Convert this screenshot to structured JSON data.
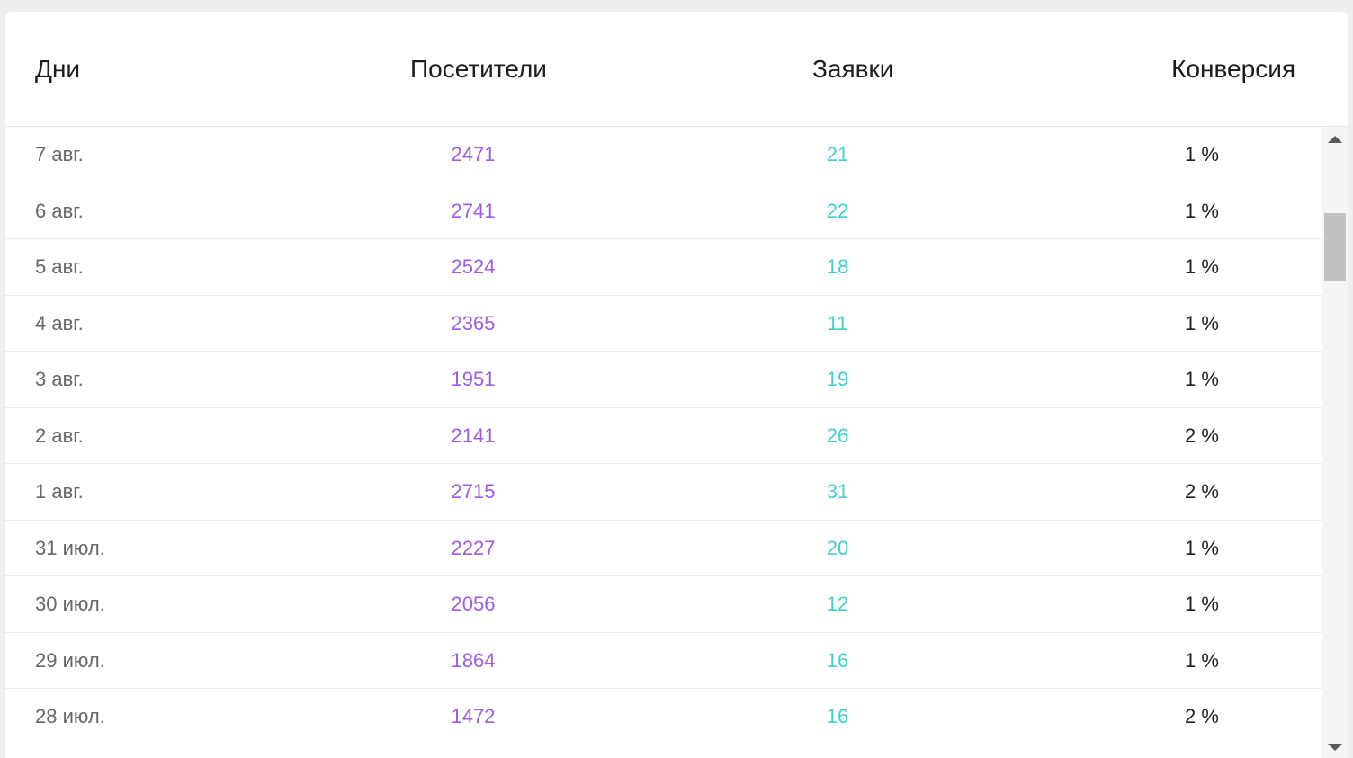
{
  "table": {
    "headers": {
      "days": "Дни",
      "visitors": "Посетители",
      "requests": "Заявки",
      "conversion": "Конверсия"
    },
    "rows": [
      {
        "day": "7 авг.",
        "visitors": "2471",
        "requests": "21",
        "conversion": "1 %"
      },
      {
        "day": "6 авг.",
        "visitors": "2741",
        "requests": "22",
        "conversion": "1 %"
      },
      {
        "day": "5 авг.",
        "visitors": "2524",
        "requests": "18",
        "conversion": "1 %"
      },
      {
        "day": "4 авг.",
        "visitors": "2365",
        "requests": "11",
        "conversion": "1 %"
      },
      {
        "day": "3 авг.",
        "visitors": "1951",
        "requests": "19",
        "conversion": "1 %"
      },
      {
        "day": "2 авг.",
        "visitors": "2141",
        "requests": "26",
        "conversion": "2 %"
      },
      {
        "day": "1 авг.",
        "visitors": "2715",
        "requests": "31",
        "conversion": "2 %"
      },
      {
        "day": "31 июл.",
        "visitors": "2227",
        "requests": "20",
        "conversion": "1 %"
      },
      {
        "day": "30 июл.",
        "visitors": "2056",
        "requests": "12",
        "conversion": "1 %"
      },
      {
        "day": "29 июл.",
        "visitors": "1864",
        "requests": "16",
        "conversion": "1 %"
      },
      {
        "day": "28 июл.",
        "visitors": "1472",
        "requests": "16",
        "conversion": "2 %"
      }
    ]
  },
  "scrollbar": {
    "up_icon": "triangle-up-icon",
    "down_icon": "triangle-down-icon"
  },
  "colors": {
    "visitors": "#9b5de5",
    "requests": "#3fcfcf",
    "day_text": "#666666",
    "conversion_text": "#222222"
  }
}
